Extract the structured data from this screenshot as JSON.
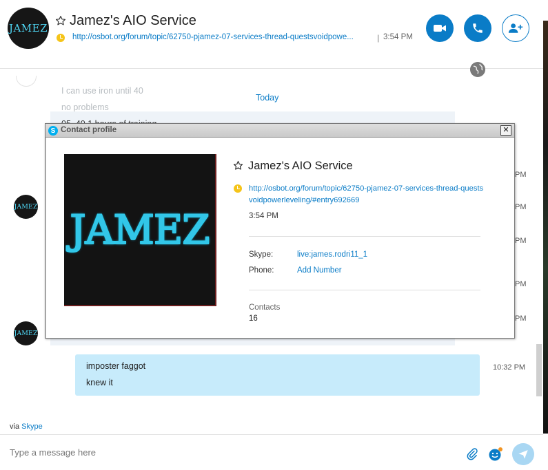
{
  "header": {
    "avatar_text": "JAMEZ",
    "title": "Jamez's AIO Service",
    "link": "http://osbot.org/forum/topic/62750-pjamez-07-services-thread-questsvoidpowe...",
    "separator": "|",
    "time": "3:54 PM"
  },
  "chat": {
    "faded_line_1": "I can use iron until 40",
    "faded_line_2": "no problems",
    "faded_line_3": "05. 40 1 hours of training",
    "today_label": "Today",
    "avatar_text": "JAMEZ",
    "time_fragment": "PM",
    "messages": [
      {
        "line1": "imposter faggot",
        "line2": "knew it",
        "time": "10:32 PM"
      }
    ]
  },
  "footer": {
    "via_prefix": "via",
    "via_link": "Skype",
    "placeholder": "Type a message here"
  },
  "modal": {
    "title": "Contact profile",
    "close_label": "✕",
    "picture_text": "JAMEZ",
    "name": "Jamez's AIO Service",
    "link": "http://osbot.org/forum/topic/62750-pjamez-07-services-thread-questsvoidpowerleveling/#entry692669",
    "time": "3:54 PM",
    "skype_label": "Skype:",
    "skype_value": "live:james.rodri11_1",
    "phone_label": "Phone:",
    "phone_value": "Add Number",
    "contacts_label": "Contacts",
    "contacts_value": "16"
  },
  "colors": {
    "accent": "#0a7cc7",
    "bubble": "#c7ebfb",
    "presence": "#f5c419"
  }
}
